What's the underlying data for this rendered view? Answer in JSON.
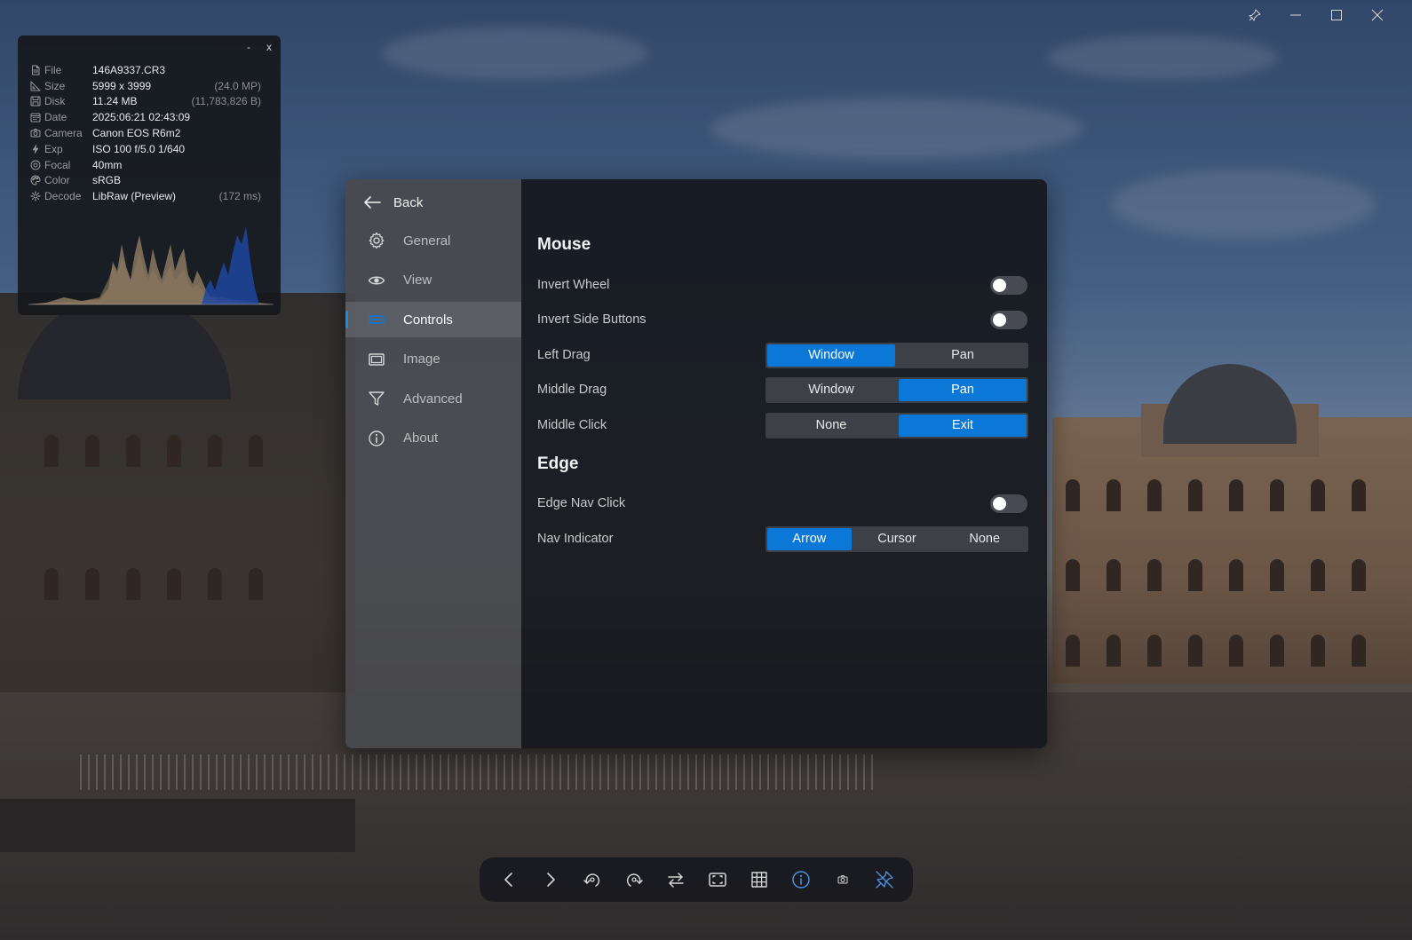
{
  "window_controls": [
    "pin-icon",
    "minimize-icon",
    "maximize-icon",
    "close-icon"
  ],
  "info_panel": {
    "minimize_label": "-",
    "close_label": "x",
    "rows": [
      {
        "icon": "file-icon",
        "label": "File",
        "value": "146A9337.CR3",
        "extra": ""
      },
      {
        "icon": "size-icon",
        "label": "Size",
        "value": "5999 x 3999",
        "extra": "(24.0 MP)"
      },
      {
        "icon": "disk-icon",
        "label": "Disk",
        "value": "11.24 MB",
        "extra": "(11,783,826 B)"
      },
      {
        "icon": "calendar-icon",
        "label": "Date",
        "value": "2025:06:21 02:43:09",
        "extra": ""
      },
      {
        "icon": "camera-icon",
        "label": "Camera",
        "value": "Canon EOS R6m2",
        "extra": ""
      },
      {
        "icon": "flash-icon",
        "label": "Exp",
        "value": "ISO 100  f/5.0  1/640",
        "extra": ""
      },
      {
        "icon": "focal-icon",
        "label": "Focal",
        "value": "40mm",
        "extra": ""
      },
      {
        "icon": "palette-icon",
        "label": "Color",
        "value": "sRGB",
        "extra": ""
      },
      {
        "icon": "decode-icon",
        "label": "Decode",
        "value": "LibRaw (Preview)",
        "extra": "(172 ms)"
      }
    ]
  },
  "settings": {
    "back_label": "Back",
    "nav": [
      {
        "label": "General",
        "icon": "gear-icon",
        "active": false
      },
      {
        "label": "View",
        "icon": "eye-icon",
        "active": false
      },
      {
        "label": "Controls",
        "icon": "controls-icon",
        "active": true
      },
      {
        "label": "Image",
        "icon": "image-icon",
        "active": false
      },
      {
        "label": "Advanced",
        "icon": "filter-icon",
        "active": false
      },
      {
        "label": "About",
        "icon": "info-icon",
        "active": false
      }
    ],
    "mouse": {
      "title": "Mouse",
      "invert_wheel": {
        "label": "Invert Wheel",
        "on": false
      },
      "invert_side_buttons": {
        "label": "Invert Side Buttons",
        "on": false
      },
      "left_drag": {
        "label": "Left Drag",
        "options": [
          "Window",
          "Pan"
        ],
        "selected": "Window"
      },
      "middle_drag": {
        "label": "Middle Drag",
        "options": [
          "Window",
          "Pan"
        ],
        "selected": "Pan"
      },
      "middle_click": {
        "label": "Middle Click",
        "options": [
          "None",
          "Exit"
        ],
        "selected": "Exit"
      }
    },
    "edge": {
      "title": "Edge",
      "edge_nav_click": {
        "label": "Edge Nav Click",
        "on": false
      },
      "nav_indicator": {
        "label": "Nav Indicator",
        "options": [
          "Arrow",
          "Cursor",
          "None"
        ],
        "selected": "Arrow"
      }
    }
  },
  "toolbar": [
    {
      "icon": "chevron-left-icon"
    },
    {
      "icon": "chevron-right-icon"
    },
    {
      "icon": "rotate-left-icon"
    },
    {
      "icon": "rotate-right-icon"
    },
    {
      "icon": "swap-icon"
    },
    {
      "icon": "fit-screen-icon"
    },
    {
      "icon": "grid-icon"
    },
    {
      "icon": "info-circle-icon",
      "active": true
    },
    {
      "icon": "camera-icon"
    },
    {
      "icon": "unpin-icon",
      "active": true
    }
  ],
  "colors": {
    "accent": "#0b78d8",
    "active_icon": "#4a8fe0",
    "sidebar_bg": "#48494e",
    "content_bg": "#16181d",
    "toggle_off": "#474a52"
  }
}
